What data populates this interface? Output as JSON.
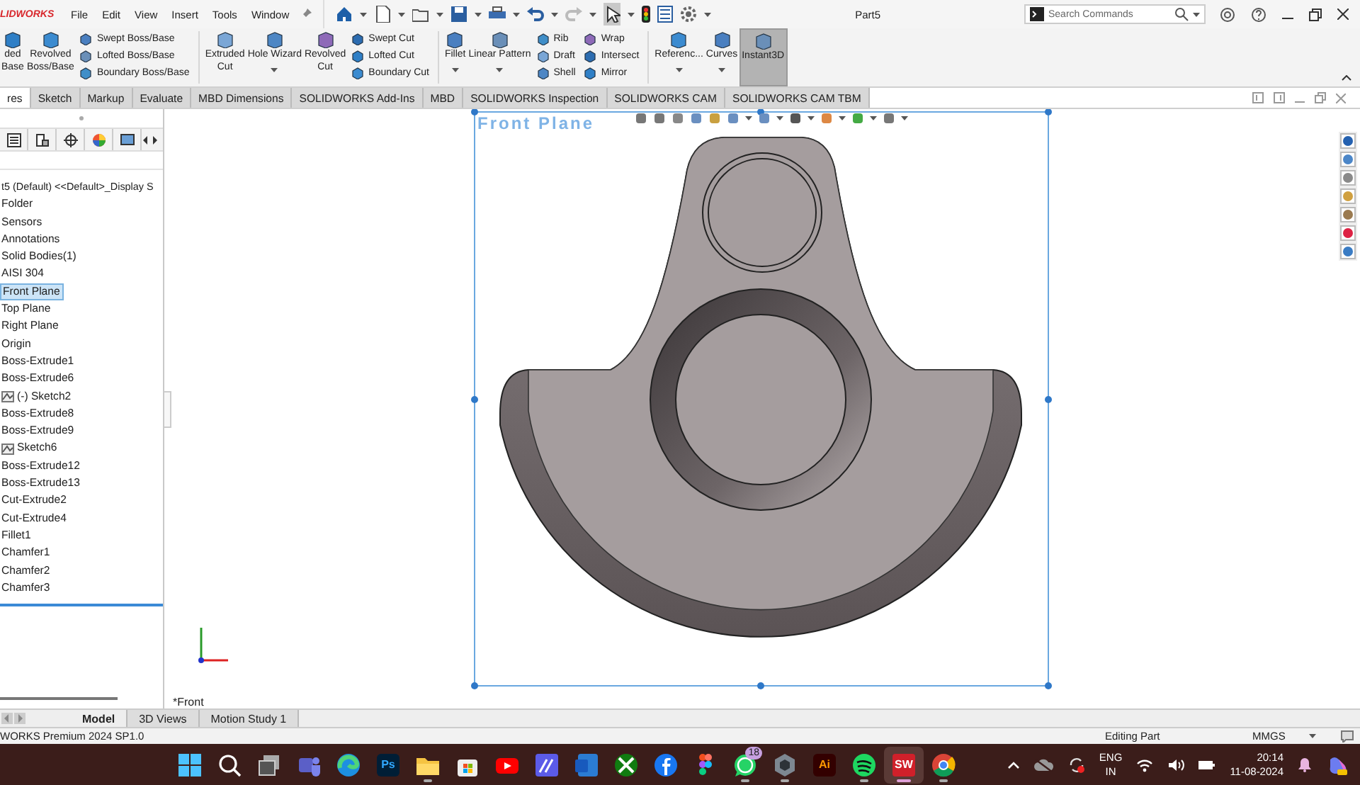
{
  "title_bar": {
    "logo": "LIDWORKS",
    "menus": [
      "File",
      "Edit",
      "View",
      "Insert",
      "Tools",
      "Window"
    ],
    "title": "Part5",
    "search": {
      "placeholder": "Search Commands"
    }
  },
  "ribbon": [
    {
      "kind": "large",
      "label": "ded\nBase",
      "selected": false
    },
    {
      "kind": "large",
      "label": "Revolved\nBoss/Base",
      "selected": false
    },
    {
      "kind": "stack",
      "items": [
        "Swept Boss/Base",
        "Lofted Boss/Base",
        "Boundary Boss/Base"
      ]
    },
    {
      "kind": "divider"
    },
    {
      "kind": "large",
      "label": "Extruded\nCut",
      "selected": false
    },
    {
      "kind": "large",
      "label": "Hole Wizard",
      "menu": true,
      "selected": false
    },
    {
      "kind": "large",
      "label": "Revolved\nCut",
      "selected": false
    },
    {
      "kind": "stack",
      "items": [
        "Swept Cut",
        "Lofted Cut",
        "Boundary Cut"
      ]
    },
    {
      "kind": "divider"
    },
    {
      "kind": "large",
      "label": "Fillet",
      "menu": true,
      "selected": false
    },
    {
      "kind": "large",
      "label": "Linear Pattern",
      "menu": true,
      "selected": false
    },
    {
      "kind": "stack",
      "items": [
        "Rib",
        "Draft",
        "Shell"
      ]
    },
    {
      "kind": "stack",
      "items": [
        "Wrap",
        "Intersect",
        "Mirror"
      ]
    },
    {
      "kind": "divider"
    },
    {
      "kind": "large",
      "label": "Referenc...",
      "menu": true,
      "selected": false
    },
    {
      "kind": "large",
      "label": "Curves",
      "menu": true,
      "selected": false
    },
    {
      "kind": "large",
      "label": "Instant3D",
      "selected": true
    }
  ],
  "tabs": [
    {
      "label": "res",
      "selected": true
    },
    {
      "label": "Sketch",
      "selected": false
    },
    {
      "label": "Markup",
      "selected": false
    },
    {
      "label": "Evaluate",
      "selected": false
    },
    {
      "label": "MBD Dimensions",
      "selected": false
    },
    {
      "label": "SOLIDWORKS Add-Ins",
      "selected": false
    },
    {
      "label": "MBD",
      "selected": false
    },
    {
      "label": "SOLIDWORKS Inspection",
      "selected": false
    },
    {
      "label": "SOLIDWORKS CAM",
      "selected": false
    },
    {
      "label": "SOLIDWORKS CAM TBM",
      "selected": false
    }
  ],
  "feature_tree": {
    "root": "t5 (Default) <<Default>_Display S",
    "items": [
      {
        "label": "Folder",
        "kind": "item",
        "selected": false
      },
      {
        "label": "Sensors",
        "kind": "item",
        "selected": false
      },
      {
        "label": "Annotations",
        "kind": "item",
        "selected": false
      },
      {
        "label": "Solid Bodies(1)",
        "kind": "item",
        "selected": false
      },
      {
        "label": "AISI 304",
        "kind": "item",
        "selected": false
      },
      {
        "label": "Front Plane",
        "kind": "item",
        "selected": true
      },
      {
        "label": "Top Plane",
        "kind": "item",
        "selected": false
      },
      {
        "label": "Right Plane",
        "kind": "item",
        "selected": false
      },
      {
        "label": "Origin",
        "kind": "item",
        "selected": false
      },
      {
        "label": "Boss-Extrude1",
        "kind": "item",
        "selected": false
      },
      {
        "label": "Boss-Extrude6",
        "kind": "item",
        "selected": false
      },
      {
        "label": "(-) Sketch2",
        "kind": "sketch",
        "selected": false
      },
      {
        "label": "Boss-Extrude8",
        "kind": "item",
        "selected": false
      },
      {
        "label": "Boss-Extrude9",
        "kind": "item",
        "selected": false
      },
      {
        "label": "Sketch6",
        "kind": "sketch",
        "selected": false
      },
      {
        "label": "Boss-Extrude12",
        "kind": "item",
        "selected": false
      },
      {
        "label": "Boss-Extrude13",
        "kind": "item",
        "selected": false
      },
      {
        "label": "Cut-Extrude2",
        "kind": "item",
        "selected": false
      },
      {
        "label": "Cut-Extrude4",
        "kind": "item",
        "selected": false
      },
      {
        "label": "Fillet1",
        "kind": "item",
        "selected": false
      },
      {
        "label": "Chamfer1",
        "kind": "item",
        "selected": false
      },
      {
        "label": "Chamfer2",
        "kind": "item",
        "selected": false
      },
      {
        "label": "Chamfer3",
        "kind": "item",
        "selected": false
      }
    ]
  },
  "viewport": {
    "view_label": "Front Plane",
    "view_name": "*Front"
  },
  "model_tabs": [
    {
      "label": "Model",
      "selected": true
    },
    {
      "label": "3D Views",
      "selected": false
    },
    {
      "label": "Motion Study 1",
      "selected": false
    }
  ],
  "status_bar": {
    "product": "WORKS Premium 2024 SP1.0",
    "mode": "Editing Part",
    "units": "MMGS"
  },
  "taskbar": {
    "apps": [
      {
        "kind": "windows",
        "running": false,
        "active": false
      },
      {
        "kind": "search",
        "running": false,
        "active": false
      },
      {
        "kind": "taskview",
        "running": false,
        "active": false
      },
      {
        "kind": "teams",
        "running": false,
        "active": false
      },
      {
        "kind": "edge",
        "running": false,
        "active": false
      },
      {
        "kind": "photoshop",
        "label": "Ps",
        "running": false,
        "active": false
      },
      {
        "kind": "explorer",
        "running": true,
        "active": false
      },
      {
        "kind": "store",
        "running": false,
        "active": false
      },
      {
        "kind": "youtube",
        "running": false,
        "active": false
      },
      {
        "kind": "tile",
        "running": false,
        "active": false
      },
      {
        "kind": "word",
        "running": false,
        "active": false
      },
      {
        "kind": "xbox",
        "running": false,
        "active": false
      },
      {
        "kind": "facebook",
        "running": false,
        "active": false
      },
      {
        "kind": "figma",
        "running": false,
        "active": false
      },
      {
        "kind": "whatsapp",
        "badge": "18",
        "running": true,
        "active": false
      },
      {
        "kind": "hexagon",
        "running": true,
        "active": false
      },
      {
        "kind": "illustrator",
        "label": "Ai",
        "running": false,
        "active": false
      },
      {
        "kind": "spotify",
        "running": true,
        "active": false
      },
      {
        "kind": "solidworks",
        "label": "SW",
        "running": true,
        "active": true
      },
      {
        "kind": "chrome",
        "running": true,
        "active": false
      }
    ],
    "tray": {
      "language": "ENG",
      "region": "IN",
      "time": "20:14",
      "date": "11-08-2024"
    }
  }
}
